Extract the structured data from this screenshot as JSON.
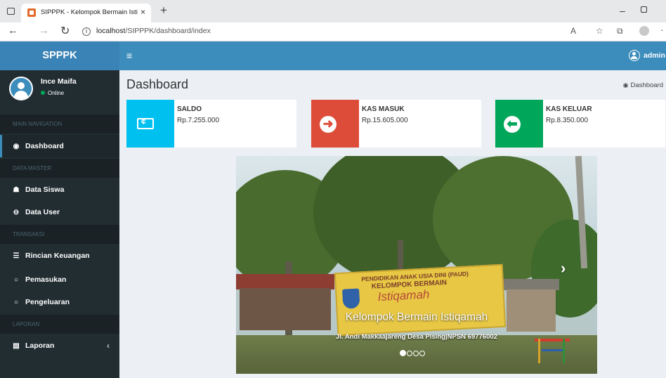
{
  "browser": {
    "tab_title": "SIPPPK - Kelompok Bermain Isti",
    "tab_close": "×",
    "new_tab": "+",
    "url_host": "localhost",
    "url_path": "/SIPPPK/dashboard/index"
  },
  "app": {
    "logo": "SPPPK",
    "user_name": "admin"
  },
  "user_panel": {
    "name": "Ince Maifa",
    "status": "Online"
  },
  "sidebar": {
    "headers": [
      "MAIN NAVIGATION",
      "DATA MASTER",
      "TRANSAKSI",
      "LAPORAN"
    ],
    "items": [
      {
        "label": "Dashboard",
        "icon": "dashboard-icon"
      },
      {
        "label": "Data Siswa",
        "icon": "users-icon"
      },
      {
        "label": "Data User",
        "icon": "user-circle-icon"
      },
      {
        "label": "Rincian Keuangan",
        "icon": "list-icon"
      },
      {
        "label": "Pemasukan",
        "icon": "circle-icon"
      },
      {
        "label": "Pengeluaran",
        "icon": "circle-icon"
      },
      {
        "label": "Laporan",
        "icon": "file-icon"
      }
    ],
    "caret": "‹"
  },
  "page": {
    "title": "Dashboard",
    "breadcrumb": "Dashboard"
  },
  "info_boxes": [
    {
      "label": "SALDO",
      "value": "Rp.7.255.000",
      "color": "#00c0ef",
      "icon": "money-icon"
    },
    {
      "label": "KAS MASUK",
      "value": "Rp.15.605.000",
      "color": "#dd4b39",
      "icon": "arrow-right-circle-icon"
    },
    {
      "label": "KAS KELUAR",
      "value": "Rp.8.350.000",
      "color": "#00a65a",
      "icon": "arrow-left-circle-icon"
    }
  ],
  "carousel": {
    "caption_title": "Kelompok Bermain Istiqamah",
    "caption_sub": "Jl. Andi Makkaajareng Desa Pising|NPSN 69776002",
    "sign_line1": "PENDIDIKAN ANAK USIA DINI (PAUD)",
    "sign_line2": "KELOMPOK BERMAIN",
    "sign_line3": "Istiqamah",
    "slides_count": 4,
    "active_slide": 1
  },
  "colors": {
    "header": "#3c8dbc",
    "sidebar": "#222d32",
    "content_bg": "#ecf0f5"
  }
}
